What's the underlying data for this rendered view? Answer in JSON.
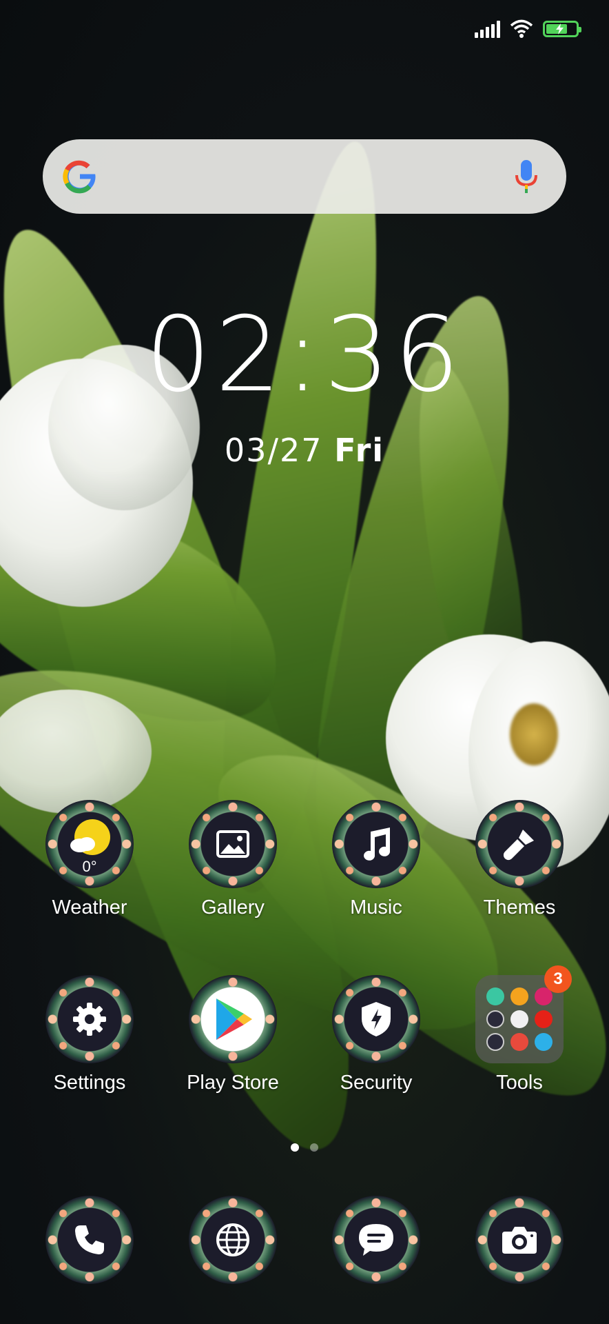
{
  "status": {
    "signal_icon": "signal-icon",
    "wifi_icon": "wifi-icon",
    "battery_icon": "battery-charging-icon",
    "battery_color": "#52d35a"
  },
  "search": {
    "logo": "google-logo-icon",
    "mic": "mic-icon"
  },
  "clock": {
    "time": "02:36",
    "date": "03/27",
    "day": "Fri"
  },
  "apps": [
    {
      "label": "Weather",
      "icon": "weather-sunny-icon",
      "temp": "0°"
    },
    {
      "label": "Gallery",
      "icon": "gallery-icon"
    },
    {
      "label": "Music",
      "icon": "music-note-icon"
    },
    {
      "label": "Themes",
      "icon": "paintbrush-icon"
    },
    {
      "label": "Settings",
      "icon": "gear-icon"
    },
    {
      "label": "Play Store",
      "icon": "play-store-icon"
    },
    {
      "label": "Security",
      "icon": "shield-icon"
    },
    {
      "label": "Tools",
      "icon": "folder-icon",
      "badge": "3"
    }
  ],
  "page_indicator": {
    "pages": 2,
    "current": 1
  },
  "dock": [
    {
      "icon": "phone-icon"
    },
    {
      "icon": "browser-globe-icon"
    },
    {
      "icon": "messages-icon"
    },
    {
      "icon": "camera-icon"
    }
  ]
}
